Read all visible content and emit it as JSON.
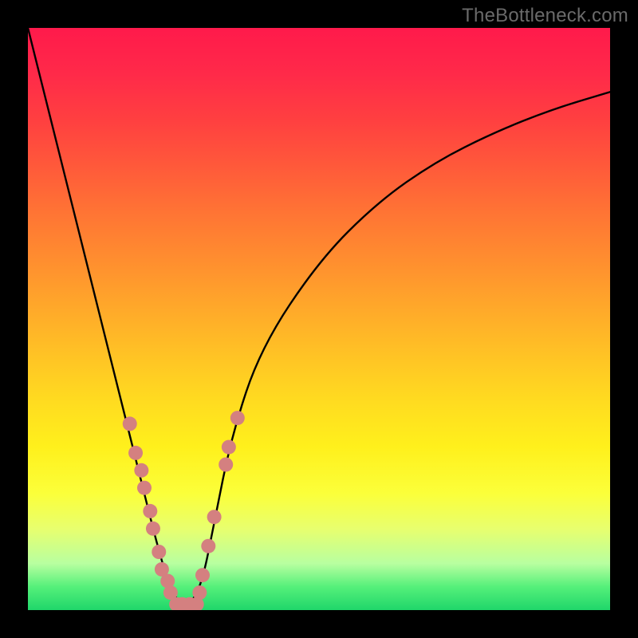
{
  "watermark": {
    "text": "TheBottleneck.com"
  },
  "chart_data": {
    "type": "line",
    "title": "",
    "xlabel": "",
    "ylabel": "",
    "xlim": [
      0,
      1
    ],
    "ylim": [
      0,
      100
    ],
    "series": [
      {
        "name": "bottleneck-curve",
        "x": [
          0.0,
          0.05,
          0.1,
          0.15,
          0.18,
          0.2,
          0.22,
          0.24,
          0.26,
          0.28,
          0.3,
          0.32,
          0.35,
          0.4,
          0.5,
          0.6,
          0.7,
          0.8,
          0.9,
          1.0
        ],
        "y": [
          100,
          80,
          60,
          40,
          28,
          20,
          12,
          5,
          1,
          1,
          5,
          15,
          30,
          45,
          60,
          70,
          77,
          82,
          86,
          89
        ]
      }
    ],
    "markers": {
      "name": "highlighted-points",
      "color": "#d48080",
      "points": [
        {
          "x": 0.175,
          "y": 32
        },
        {
          "x": 0.185,
          "y": 27
        },
        {
          "x": 0.195,
          "y": 24
        },
        {
          "x": 0.2,
          "y": 21
        },
        {
          "x": 0.21,
          "y": 17
        },
        {
          "x": 0.215,
          "y": 14
        },
        {
          "x": 0.225,
          "y": 10
        },
        {
          "x": 0.23,
          "y": 7
        },
        {
          "x": 0.24,
          "y": 5
        },
        {
          "x": 0.245,
          "y": 3
        },
        {
          "x": 0.255,
          "y": 1
        },
        {
          "x": 0.265,
          "y": 1
        },
        {
          "x": 0.278,
          "y": 1
        },
        {
          "x": 0.29,
          "y": 1
        },
        {
          "x": 0.295,
          "y": 3
        },
        {
          "x": 0.3,
          "y": 6
        },
        {
          "x": 0.31,
          "y": 11
        },
        {
          "x": 0.32,
          "y": 16
        },
        {
          "x": 0.34,
          "y": 25
        },
        {
          "x": 0.345,
          "y": 28
        },
        {
          "x": 0.36,
          "y": 33
        }
      ]
    },
    "annotations": [
      {
        "text": "TheBottleneck.com",
        "pos": "top-right"
      }
    ]
  }
}
